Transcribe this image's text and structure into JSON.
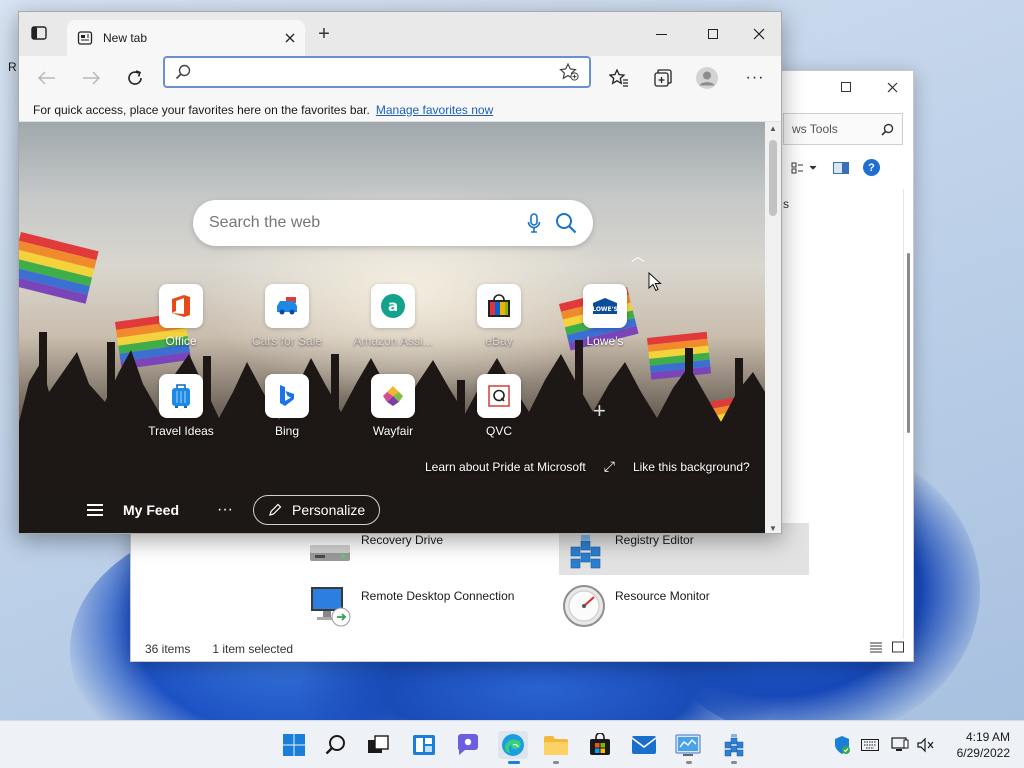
{
  "desktop": {
    "fragment_label": "R"
  },
  "explorer": {
    "search_placeholder": "ws Tools",
    "left_pane_fragment": "s",
    "items": [
      {
        "name": "Recovery Drive",
        "icon": "drive-icon"
      },
      {
        "name": "Registry Editor",
        "icon": "registry-icon"
      },
      {
        "name": "Remote Desktop Connection",
        "icon": "remote-desktop-icon"
      },
      {
        "name": "Resource Monitor",
        "icon": "resource-monitor-icon"
      }
    ],
    "status": {
      "count": "36 items",
      "selection": "1 item selected"
    }
  },
  "browser": {
    "tab_title": "New tab",
    "address_value": "",
    "favorites_bar": {
      "message": "For quick access, place your favorites here on the favorites bar.",
      "link": "Manage favorites now"
    },
    "ntp": {
      "search_placeholder": "Search the web",
      "tiles": [
        {
          "label": "Office"
        },
        {
          "label": "Cars for Sale"
        },
        {
          "label": "Amazon Assi..."
        },
        {
          "label": "eBay"
        },
        {
          "label": "Lowe's",
          "logo_text": "LOWE'S"
        },
        {
          "label": "Travel Ideas"
        },
        {
          "label": "Bing"
        },
        {
          "label": "Wayfair"
        },
        {
          "label": "QVC"
        }
      ],
      "bg_link": "Learn about Pride at Microsoft",
      "like_bg": "Like this background?",
      "feed_label": "My Feed",
      "personalize": "Personalize"
    },
    "colors": {
      "accent": "#1c5fb8",
      "address_border": "#6c8fcf"
    }
  },
  "taskbar": {
    "clock_time": "4:19 AM",
    "clock_date": "6/29/2022"
  }
}
